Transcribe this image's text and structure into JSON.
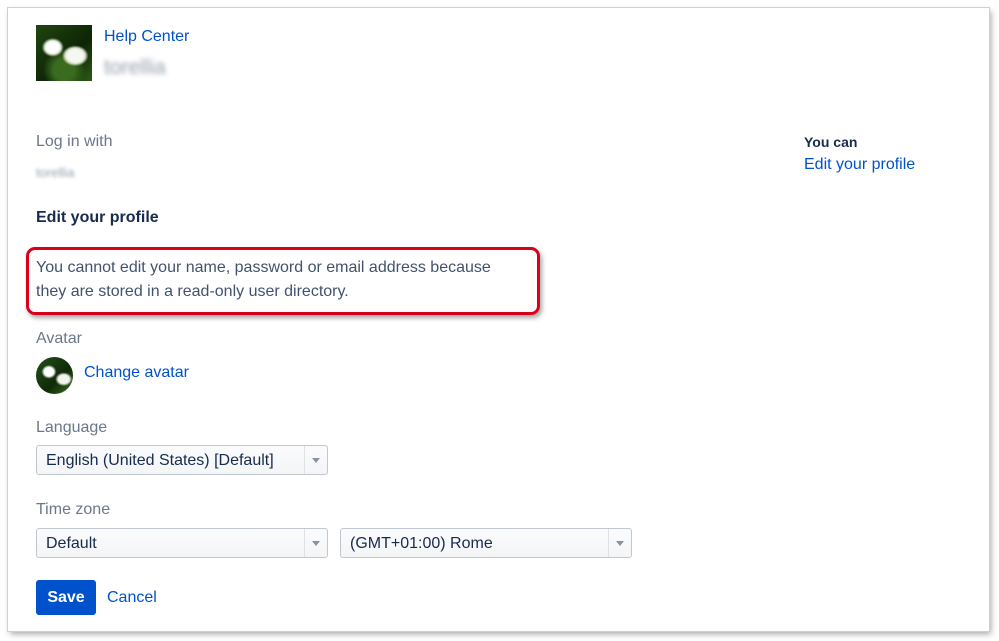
{
  "header": {
    "help_center": "Help Center",
    "site_name": "torellia"
  },
  "login": {
    "label": "Log in with",
    "value": "torellia"
  },
  "profile": {
    "section_title": "Edit your profile",
    "notice": "You cannot edit your name, password or email address because they are stored in a read-only user directory.",
    "notice_highlight_color": "#d9001b"
  },
  "avatar": {
    "label": "Avatar",
    "change_link": "Change avatar"
  },
  "language": {
    "label": "Language",
    "selected": "English (United States) [Default]"
  },
  "timezone": {
    "label": "Time zone",
    "region_selected": "Default",
    "city_selected": "(GMT+01:00) Rome"
  },
  "actions": {
    "save": "Save",
    "cancel": "Cancel"
  },
  "sidebar": {
    "heading": "You can",
    "edit_profile_link": "Edit your profile"
  },
  "colors": {
    "link": "#0052cc",
    "primary_button": "#0052cc"
  }
}
